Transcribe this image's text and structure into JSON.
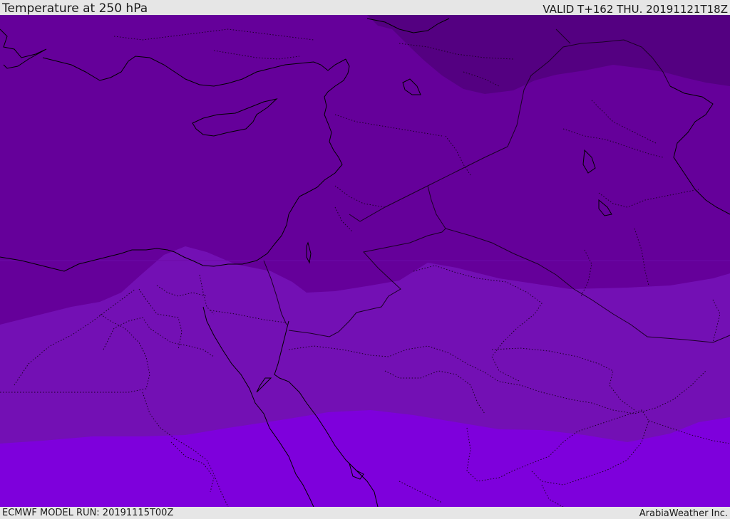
{
  "header": {
    "title": "Temperature at 250 hPa",
    "valid": "VALID T+162 THU. 20191121T18Z"
  },
  "footer": {
    "model_run": "ECMWF MODEL RUN: 20191115T00Z",
    "credit": "ArabiaWeather Inc."
  },
  "map": {
    "colors": {
      "band_coldest": "#540081",
      "band_cold": "#65009a",
      "band_mid": "#7310b4",
      "band_warm": "#7e00dc",
      "coastline": "#000000",
      "border": "#1a0025"
    }
  }
}
